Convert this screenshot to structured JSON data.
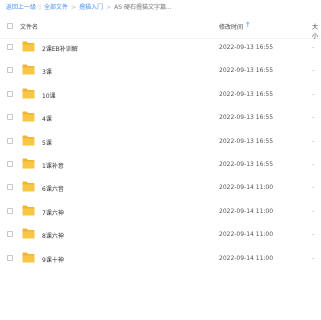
{
  "breadcrumb": {
    "items": [
      {
        "label": "返回上一级",
        "link": true
      },
      {
        "label": "全部文件",
        "link": true
      },
      {
        "label": "撸猫入门",
        "link": true
      },
      {
        "label": "AS·硬石撸猫文字篇...",
        "link": false
      }
    ]
  },
  "header": {
    "col_name": "文件名",
    "col_time": "修改时间",
    "sort_indicator": "↑",
    "col_size": "大小"
  },
  "files": [
    {
      "name": "2课EB补训解",
      "time": "2022-09-13 16:55",
      "size": "-"
    },
    {
      "name": "3课",
      "time": "2022-09-13 16:55",
      "size": "-"
    },
    {
      "name": "10课",
      "time": "2022-09-13 16:55",
      "size": "-"
    },
    {
      "name": "4课",
      "time": "2022-09-13 16:55",
      "size": "-"
    },
    {
      "name": "5课",
      "time": "2022-09-13 16:55",
      "size": "-"
    },
    {
      "name": "1课补意",
      "time": "2022-09-13 16:55",
      "size": "-"
    },
    {
      "name": "6课六音",
      "time": "2022-09-14 11:00",
      "size": "-"
    },
    {
      "name": "7课六神",
      "time": "2022-09-14 11:00",
      "size": "-"
    },
    {
      "name": "8课六神",
      "time": "2022-09-14 11:00",
      "size": "-"
    },
    {
      "name": "9课十神",
      "time": "2022-09-14 11:00",
      "size": "-"
    }
  ],
  "colors": {
    "link": "#4a8ff0",
    "folder": "#f7c744",
    "folder_tab": "#f2b531"
  },
  "icons": {
    "row_icon": "folder-icon",
    "sort_icon": "sort-ascending-icon"
  }
}
